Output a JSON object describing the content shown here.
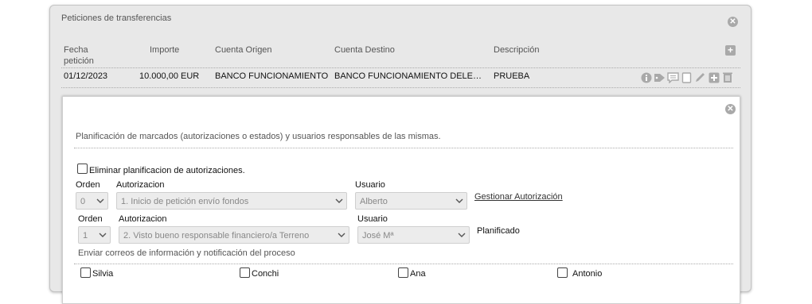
{
  "panel": {
    "title": "Peticiones de transferencias",
    "close_icon": "circle-x-icon",
    "add_icon": "plus-icon"
  },
  "table": {
    "headers": [
      "Fecha\npetición",
      "Importe",
      "Cuenta Origen",
      "Cuenta Destino",
      "Descripción"
    ],
    "header_line1": "Fecha",
    "header_line2": "petición",
    "rows": [
      {
        "fecha": "01/12/2023",
        "importe": "10.000,00 EUR",
        "cuenta_origen": "BANCO FUNCIONAMIENTO",
        "cuenta_destino": "BANCO FUNCIONAMIENTO DELEGACION",
        "descripcion": "PRUEBA",
        "actions": [
          "info-icon",
          "tag-icon",
          "comment-icon",
          "document-icon",
          "pencil-icon",
          "plus-icon",
          "trash-icon"
        ]
      }
    ]
  },
  "planning": {
    "description": "Planificación de marcados (autorizaciones o estados) y usuarios responsables de las mismas.",
    "eliminar_label": "Eliminar planificacion de autorizaciones.",
    "eliminar_checked": false,
    "steps": [
      {
        "orden_label": "Orden",
        "autorizacion_label": "Autorizacion",
        "usuario_label": "Usuario",
        "orden": "0",
        "autorizacion": "1. Inicio de petición envío fondos",
        "usuario": "Alberto",
        "action_link": "Gestionar Autorización"
      },
      {
        "orden_label": "Orden",
        "autorizacion_label": "Autorizacion",
        "usuario_label": "Usuario",
        "orden": "1",
        "autorizacion": "2. Visto bueno responsable financiero/a Terreno",
        "usuario": "José Mª",
        "status": "Planificado"
      }
    ],
    "notify_label": "Enviar correos de información y notificación del proceso",
    "recipients": [
      {
        "name": "Silvia",
        "checked": false
      },
      {
        "name": "Conchi",
        "checked": false
      },
      {
        "name": "Ana",
        "checked": false
      },
      {
        "name": "Antonio",
        "checked": false
      }
    ]
  },
  "colors": {
    "panel_bg": "#e8e8e8",
    "icon_gray": "#a9a9a9",
    "disabled_select_bg": "#ececec"
  }
}
